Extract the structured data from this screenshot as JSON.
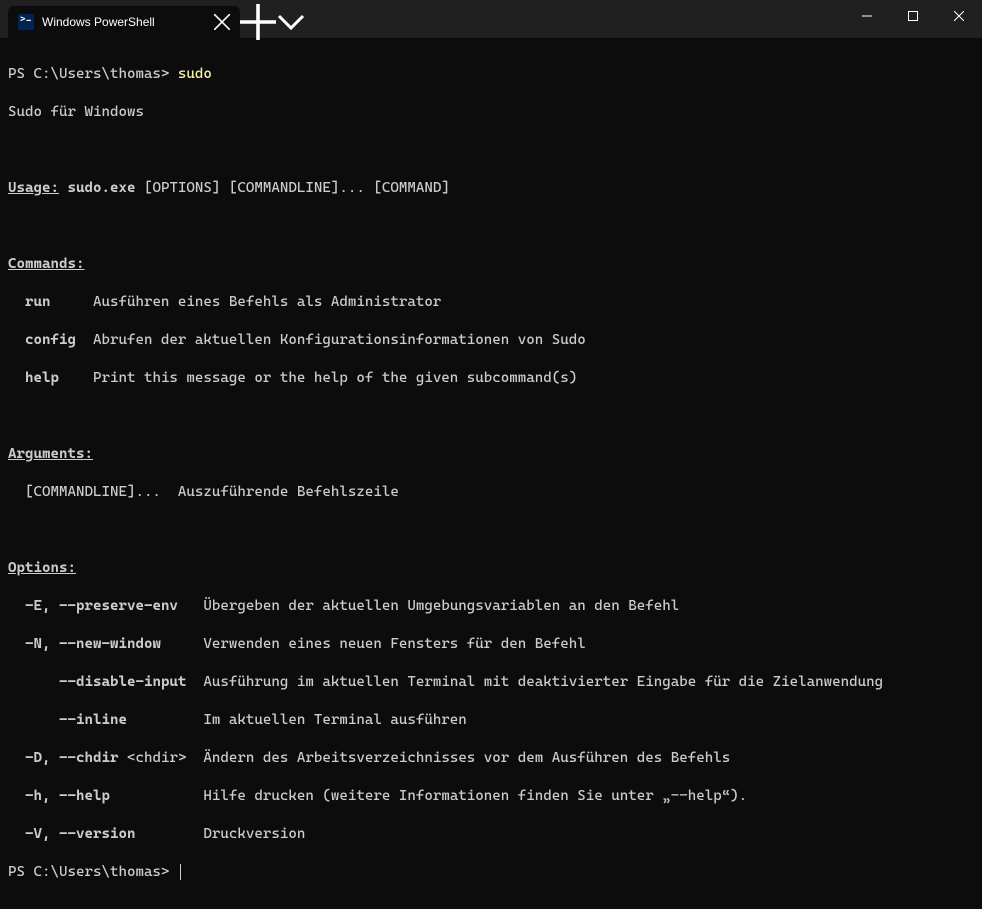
{
  "titlebar": {
    "tab_title": "Windows PowerShell"
  },
  "terminal": {
    "prompt1": "PS C:\\Users\\thomas> ",
    "cmd1": "sudo",
    "line2": "Sudo für Windows",
    "usage_label": "Usage:",
    "usage_exe": " sudo.exe ",
    "usage_rest": "[OPTIONS] [COMMANDLINE]... [COMMAND]",
    "commands_label": "Commands:",
    "cmd_run_name": "  run",
    "cmd_run_desc": "     Ausführen eines Befehls als Administrator",
    "cmd_config_name": "  config",
    "cmd_config_desc": "  Abrufen der aktuellen Konfigurationsinformationen von Sudo",
    "cmd_help_name": "  help",
    "cmd_help_desc": "    Print this message or the help of the given subcommand(s)",
    "arguments_label": "Arguments:",
    "arg_line": "  [COMMANDLINE]...  Auszuführende Befehlszeile",
    "options_label": "Options:",
    "opt_E_flags_short": "  -E, ",
    "opt_E_flags_long": "--preserve-env",
    "opt_E_desc": "   Übergeben der aktuellen Umgebungsvariablen an den Befehl",
    "opt_N_flags_short": "  -N, ",
    "opt_N_flags_long": "--new-window",
    "opt_N_desc": "     Verwenden eines neuen Fensters für den Befehl",
    "opt_di_flags_pad": "      ",
    "opt_di_flags_long": "--disable-input",
    "opt_di_desc": "  Ausführung im aktuellen Terminal mit deaktivierter Eingabe für die Zielanwendung",
    "opt_il_flags_pad": "      ",
    "opt_il_flags_long": "--inline",
    "opt_il_desc": "         Im aktuellen Terminal ausführen",
    "opt_D_flags_short": "  -D, ",
    "opt_D_flags_long": "--chdir",
    "opt_D_arg": " <chdir>",
    "opt_D_desc": "  Ändern des Arbeitsverzeichnisses vor dem Ausführen des Befehls",
    "opt_h_flags_short": "  -h, ",
    "opt_h_flags_long": "--help",
    "opt_h_desc": "           Hilfe drucken (weitere Informationen finden Sie unter „--help“).",
    "opt_V_flags_short": "  -V, ",
    "opt_V_flags_long": "--version",
    "opt_V_desc": "        Druckversion",
    "prompt2": "PS C:\\Users\\thomas> "
  }
}
